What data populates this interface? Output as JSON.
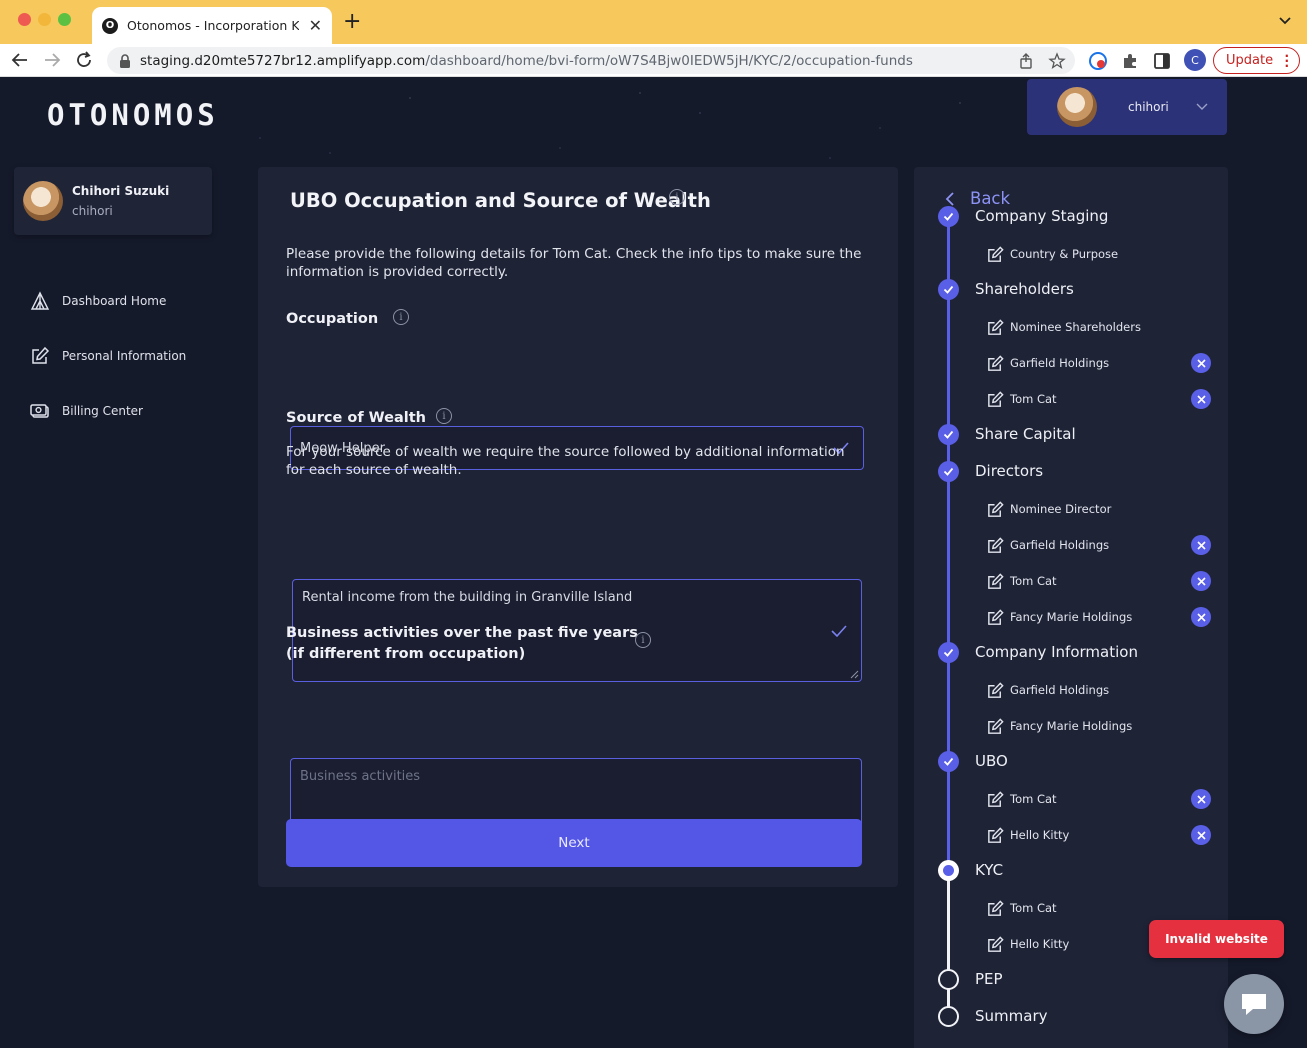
{
  "browser": {
    "tab_title": "Otonomos - Incorporation Kits",
    "tab_favicon": "O",
    "url_host": "staging.d20mte5727br12.amplifyapp.com",
    "url_path": "/dashboard/home/bvi-form/oW7S4Bjw0IEDW5jH/KYC/2/occupation-funds",
    "profile_initial": "C",
    "update_label": "Update"
  },
  "header": {
    "logo": "OTONOMOS",
    "username": "chihori"
  },
  "sidebar": {
    "profile_name": "Chihori Suzuki",
    "profile_handle": "chihori",
    "items": [
      {
        "label": "Dashboard Home",
        "icon": "tent-icon"
      },
      {
        "label": "Personal Information",
        "icon": "edit-icon"
      },
      {
        "label": "Billing Center",
        "icon": "money-icon"
      }
    ]
  },
  "form": {
    "title": "UBO Occupation and Source of Wealth",
    "intro": "Please provide the following details for Tom Cat. Check the info tips to make sure the information is provided correctly.",
    "occupation_label": "Occupation",
    "occupation_value": "Meow Helper",
    "wealth_label": "Source of Wealth",
    "wealth_desc": "For your source of wealth we require the source followed by additional information for each source of wealth.",
    "wealth_value": "Rental income from the building in Granville Island",
    "business_label_line1": "Business activities over the past five years",
    "business_label_line2": "(if different from occupation)",
    "business_placeholder": "Business activities",
    "next_label": "Next"
  },
  "stepper": {
    "back_label": "Back",
    "steps": [
      {
        "label": "Company Staging",
        "status": "done",
        "subs": [
          {
            "label": "Country & Purpose",
            "removable": false
          }
        ]
      },
      {
        "label": "Shareholders",
        "status": "done",
        "subs": [
          {
            "label": "Nominee Shareholders",
            "removable": false
          },
          {
            "label": "Garfield Holdings",
            "removable": true
          },
          {
            "label": "Tom Cat",
            "removable": true
          }
        ]
      },
      {
        "label": "Share Capital",
        "status": "done",
        "subs": []
      },
      {
        "label": "Directors",
        "status": "done",
        "subs": [
          {
            "label": "Nominee Director",
            "removable": false
          },
          {
            "label": "Garfield Holdings",
            "removable": true
          },
          {
            "label": "Tom Cat",
            "removable": true
          },
          {
            "label": "Fancy Marie Holdings",
            "removable": true
          }
        ]
      },
      {
        "label": "Company Information",
        "status": "done",
        "subs": [
          {
            "label": "Garfield Holdings",
            "removable": false
          },
          {
            "label": "Fancy Marie Holdings",
            "removable": false
          }
        ]
      },
      {
        "label": "UBO",
        "status": "done",
        "subs": [
          {
            "label": "Tom Cat",
            "removable": true
          },
          {
            "label": "Hello Kitty",
            "removable": true
          }
        ]
      },
      {
        "label": "KYC",
        "status": "current",
        "subs": [
          {
            "label": "Tom Cat",
            "removable": false
          },
          {
            "label": "Hello Kitty",
            "removable": false
          }
        ]
      },
      {
        "label": "PEP",
        "status": "todo",
        "subs": []
      },
      {
        "label": "Summary",
        "status": "todo",
        "subs": []
      }
    ]
  },
  "overlays": {
    "invalid_label": "Invalid website"
  },
  "colors": {
    "accent": "#5a5fe8",
    "background": "#151a2b",
    "card": "#1e2336",
    "error": "#e5303f"
  }
}
